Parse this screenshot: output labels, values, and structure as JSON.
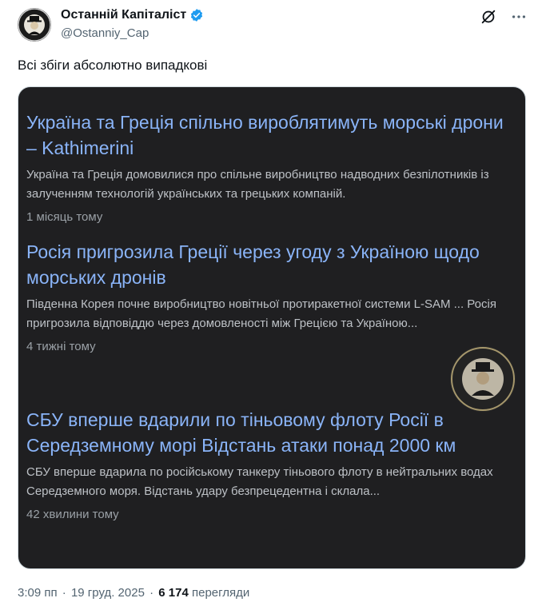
{
  "author": {
    "display_name": "Останній Капіталіст",
    "handle": "@Ostanniy_Cap",
    "verified_color": "#1d9bf0",
    "avatar_text": "Останній Капіталіст"
  },
  "tweet": {
    "text": "Всі збіги абсолютно випадкові"
  },
  "articles": [
    {
      "title": "Україна та Греція спільно вироблятимуть морські дрони – Kathimerini",
      "snippet": "Україна та Греція домовилися про спільне виробництво надводних безпілотників із залученням технологій українських та грецьких компаній.",
      "time": "1 місяць тому"
    },
    {
      "title": "Росія пригрозила Греції через угоду з Україною щодо морських дронів",
      "snippet": "Південна Корея почне виробництво новітньої протиракетної системи L-SAM ... Росія пригрозила відповіддю через домовленості між Грецією та Україною...",
      "time": "4 тижні тому"
    },
    {
      "title": "СБУ вперше вдарили по тіньовому флоту Росії в Середземному морі Відстань атаки понад 2000 км",
      "snippet": "СБУ вперше вдарила по російському танкеру тіньового флоту в нейтральних водах Середземного моря. Відстань удару безпрецедентна і склала...",
      "time": "42 хвилини тому"
    }
  ],
  "watermark": {
    "text": "Останній Капіталіст"
  },
  "footer": {
    "time": "3:09 пп",
    "date": "19 груд. 2025",
    "views_count": "6 174",
    "views_label": "перегляди"
  },
  "icons": {
    "grok": "grok-icon",
    "more": "more-icon",
    "verified": "verified-badge-icon"
  }
}
